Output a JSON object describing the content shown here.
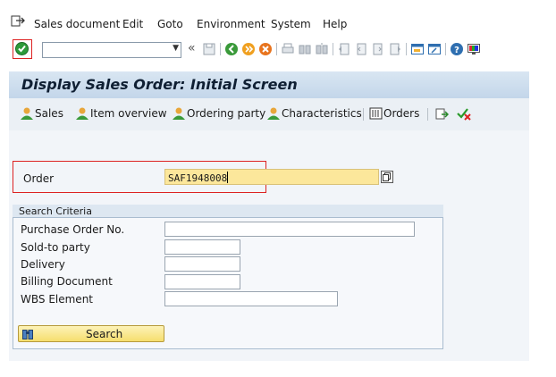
{
  "menu": {
    "items": [
      "Sales document",
      "Edit",
      "Goto",
      "Environment",
      "System",
      "Help"
    ]
  },
  "toolbar": {
    "command_value": "",
    "back_glyph": "«",
    "icons": [
      "enter-icon",
      "save-icon",
      "back-icon",
      "exit-icon",
      "cancel-icon",
      "print-icon",
      "find-icon",
      "find-next-icon",
      "first-page-icon",
      "previous-page-icon",
      "next-page-icon",
      "last-page-icon",
      "new-session-icon",
      "shortcut-icon",
      "help-icon",
      "customize-layout-icon"
    ]
  },
  "title": "Display Sales Order: Initial Screen",
  "app_toolbar": {
    "sales": "Sales",
    "item_overview": "Item overview",
    "ordering_party": "Ordering party",
    "characteristics": "Characteristics",
    "orders": "Orders"
  },
  "order": {
    "label": "Order",
    "value": "SAF1948008"
  },
  "search_criteria": {
    "title": "Search Criteria",
    "purchase_order_label": "Purchase Order No.",
    "purchase_order_value": "",
    "sold_to_label": "Sold-to party",
    "sold_to_value": "",
    "delivery_label": "Delivery",
    "delivery_value": "",
    "billing_label": "Billing Document",
    "billing_value": "",
    "wbs_label": "WBS Element",
    "wbs_value": "",
    "search_button": "Search"
  },
  "colors": {
    "title_bar": "#c3d6ea",
    "required_field": "#fce79b",
    "highlight_border": "#dd2222",
    "ok_green": "#2e9a3a"
  }
}
